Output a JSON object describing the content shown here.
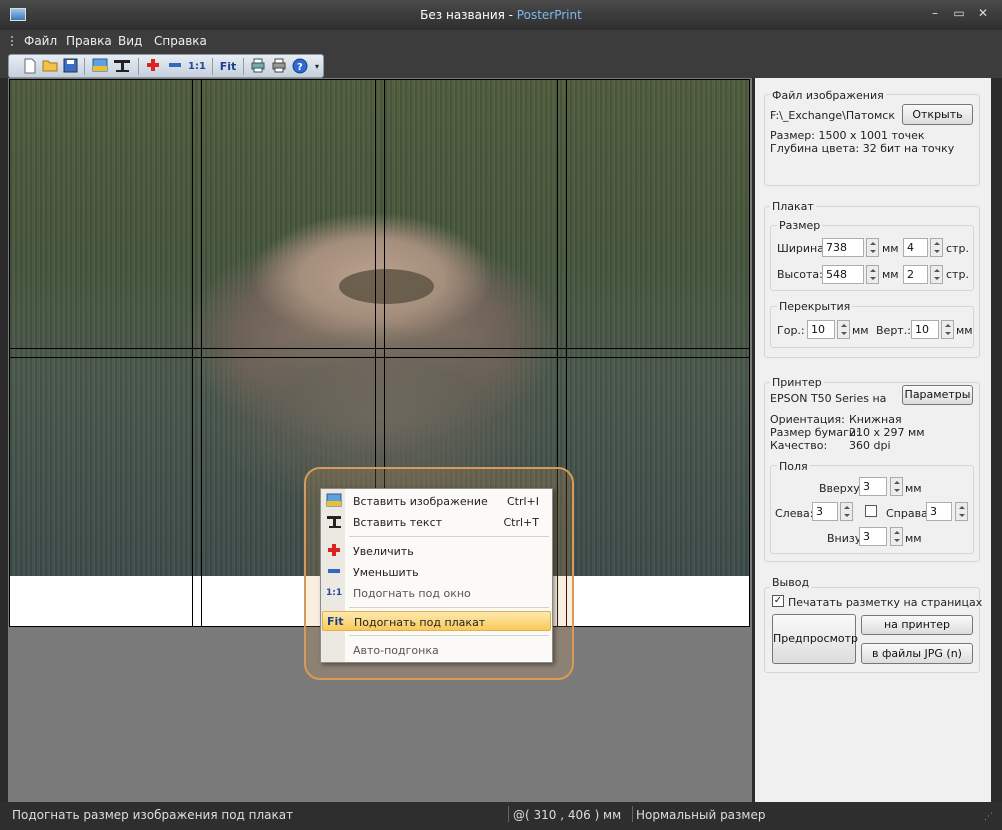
{
  "window": {
    "title_main": "Без названия - ",
    "title_brand": "PosterPrint",
    "controls": [
      "–",
      "▭",
      "✕"
    ]
  },
  "menu": [
    "Файл",
    "Правка",
    "Вид",
    "Справка"
  ],
  "toolbar": {
    "fit_label": "Fit",
    "zoom_actual_label": "1:1"
  },
  "context_menu": {
    "items": [
      {
        "label": "Вставить изображение",
        "shortcut": "Ctrl+I",
        "icon": "insert-image-icon",
        "enabled": true
      },
      {
        "label": "Вставить текст",
        "shortcut": "Ctrl+T",
        "icon": "insert-text-icon",
        "enabled": true
      },
      {
        "label": "Увеличить",
        "shortcut": "",
        "icon": "zoom-in-icon",
        "enabled": true
      },
      {
        "label": "Уменьшить",
        "shortcut": "",
        "icon": "zoom-out-icon",
        "enabled": true
      },
      {
        "label": "Подогнать под окно",
        "shortcut": "",
        "icon": "fit-window-icon",
        "enabled": false
      },
      {
        "label": "Подогнать под плакат",
        "shortcut": "",
        "icon": "fit-poster-icon",
        "enabled": true,
        "highlighted": true
      },
      {
        "label": "Авто-подгонка",
        "shortcut": "",
        "icon": "",
        "enabled": false
      }
    ],
    "icon_text_1_1": "1:1",
    "icon_text_fit": "Fit"
  },
  "image_file": {
    "group_title": "Файл изображения",
    "path": "F:\\_Exchange\\Патомский",
    "open_button": "Открыть",
    "size": "Размер: 1500 x 1001 точек",
    "depth": "Глубина цвета: 32 бит на точку"
  },
  "poster": {
    "group_title": "Плакат",
    "size_title": "Размер",
    "width_label": "Ширина:",
    "width_value": "738",
    "height_label": "Высота:",
    "height_value": "548",
    "unit_mm": "мм",
    "pages_w": "4",
    "pages_h": "2",
    "unit_pages": "стр.",
    "overlap_title": "Перекрытия",
    "hor_label": "Гор.:",
    "hor_value": "10",
    "vert_label": "Верт.:",
    "vert_value": "10"
  },
  "printer": {
    "group_title": "Принтер",
    "name": "EPSON T50 Series на",
    "params_button": "Параметры",
    "orientation_label": "Ориентация:",
    "orientation_value": "Книжная",
    "paper_label": "Размер бумаги:",
    "paper_value": "210 x 297 мм",
    "quality_label": "Качество:",
    "quality_value": "360 dpi",
    "margins_title": "Поля",
    "top_label": "Вверху:",
    "top_value": "3",
    "left_label": "Слева:",
    "left_value": "3",
    "right_label": "Справа:",
    "right_value": "3",
    "bottom_label": "Внизу:",
    "bottom_value": "3"
  },
  "output": {
    "group_title": "Вывод",
    "print_marks_label": "Печатать разметку на страницах",
    "print_marks_checked": true,
    "preview_button": "Предпросмотр",
    "to_printer_button": "на принтер",
    "to_jpg_button": "в файлы JPG (n)"
  },
  "status": {
    "message": "Подогнать размер изображения под плакат",
    "coords": "@( 310 , 406 ) мм",
    "zoom": "Нормальный размер"
  }
}
